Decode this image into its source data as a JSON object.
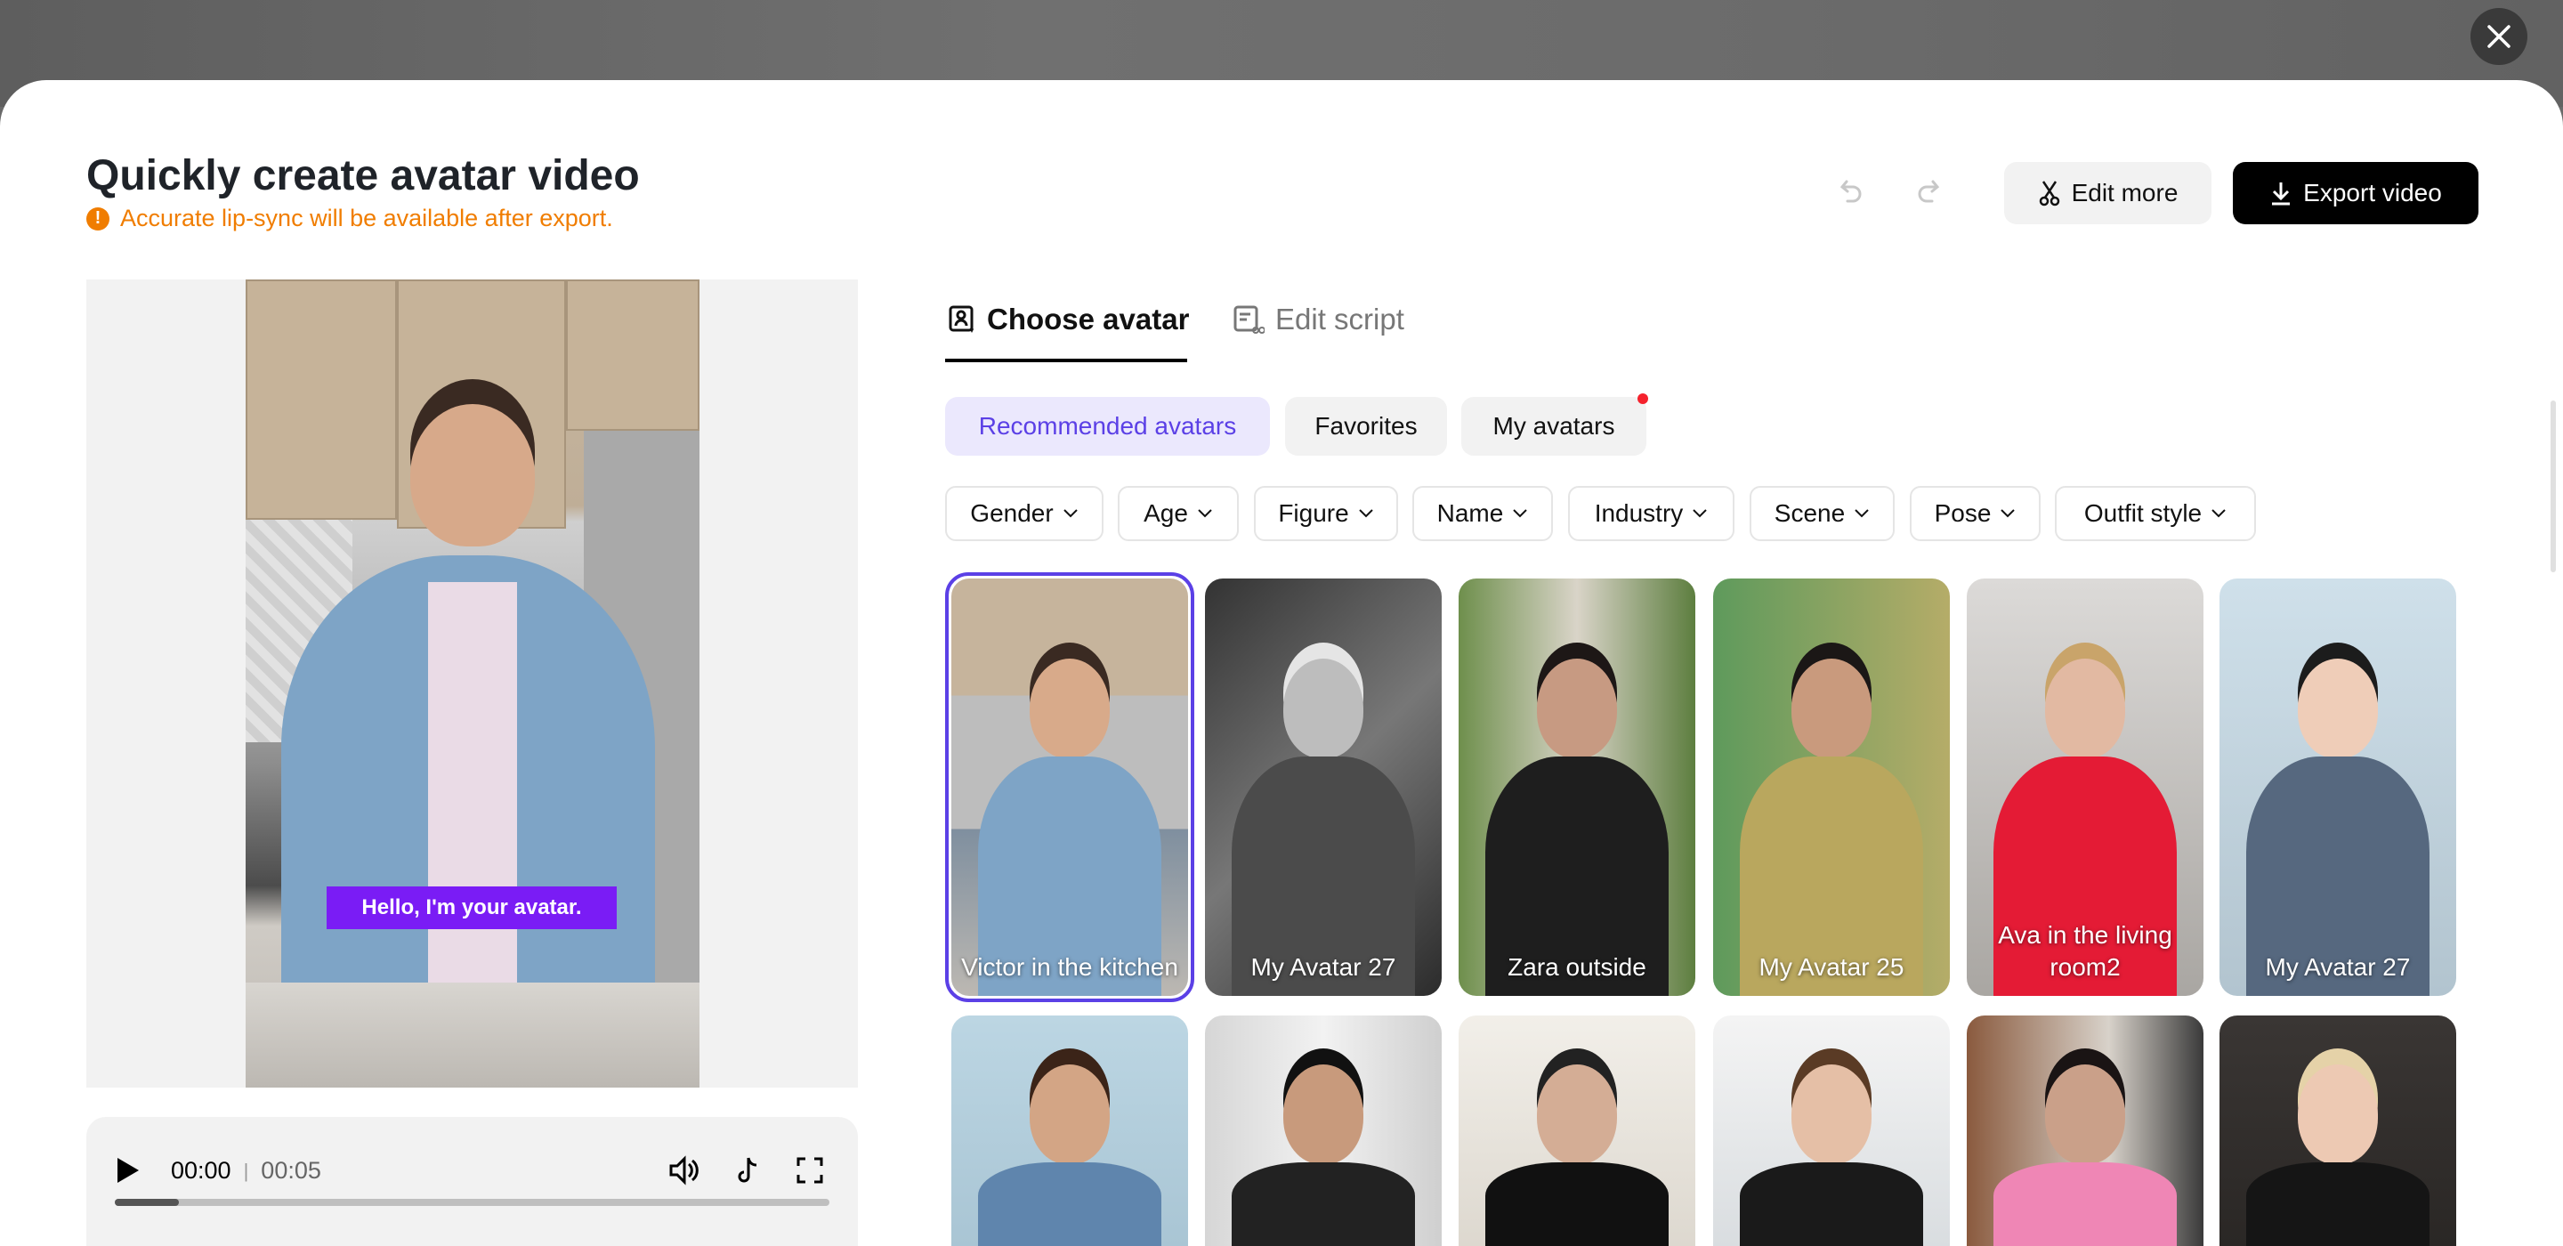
{
  "header": {
    "title": "Quickly create avatar video",
    "warning": "Accurate lip-sync will be available after export.",
    "edit_more": "Edit more",
    "export": "Export video"
  },
  "preview": {
    "subtitle": "Hello, I'm your avatar."
  },
  "player": {
    "current": "00:00",
    "separator": "|",
    "duration": "00:05",
    "progress_percent": 9
  },
  "tabs": [
    {
      "label": "Choose avatar",
      "active": true
    },
    {
      "label": "Edit script",
      "active": false
    }
  ],
  "categories": [
    {
      "label": "Recommended avatars",
      "active": true
    },
    {
      "label": "Favorites"
    },
    {
      "label": "My avatars",
      "has_notification": true
    }
  ],
  "filters": [
    "Gender",
    "Age",
    "Figure",
    "Name",
    "Industry",
    "Scene",
    "Pose",
    "Outfit style"
  ],
  "avatars_row1": [
    {
      "name": "Victor in the kitchen",
      "selected": true
    },
    {
      "name": "My Avatar 27"
    },
    {
      "name": "Zara outside"
    },
    {
      "name": "My Avatar 25"
    },
    {
      "name": "Ava in the living room2"
    },
    {
      "name": "My Avatar 27"
    }
  ],
  "colors": {
    "accent": "#5b40e6",
    "warning": "#f07d00",
    "subtitle_bg": "#7a1cf5",
    "notification": "#f5222d"
  }
}
